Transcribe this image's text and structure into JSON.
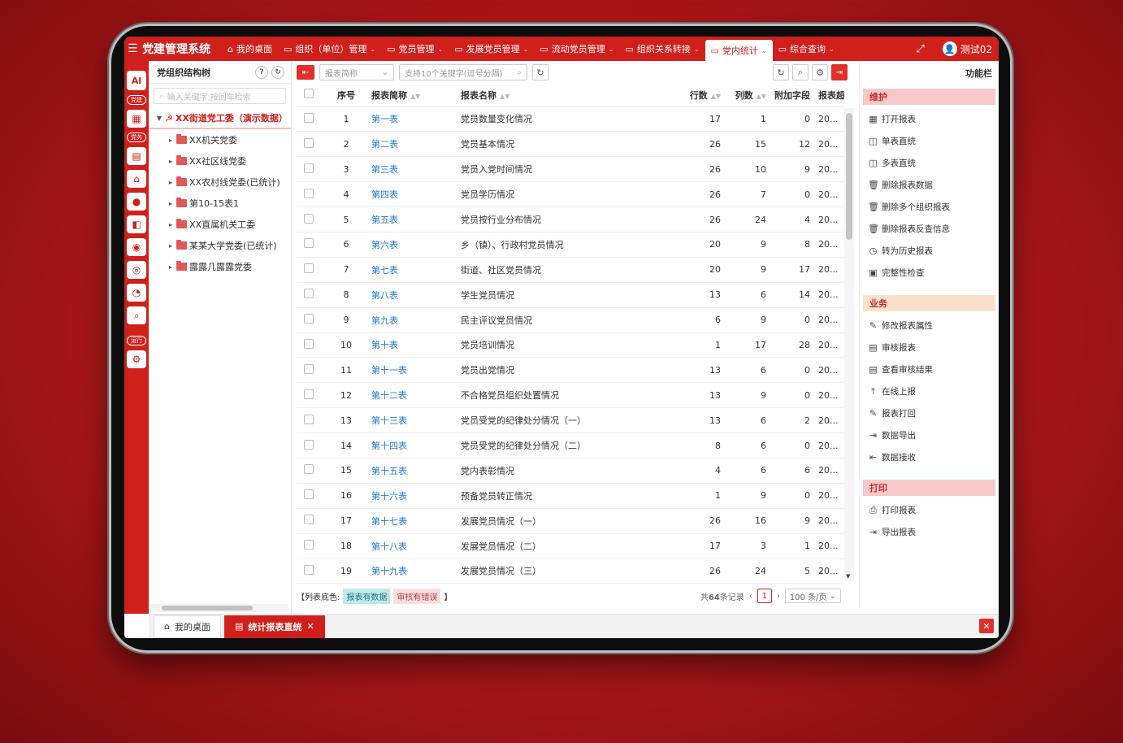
{
  "app": {
    "title": "党建管理系统",
    "user": "测试02"
  },
  "nav": [
    {
      "label": "我的桌面",
      "icon": "home-icon",
      "dropdown": false,
      "active": false
    },
    {
      "label": "组织（单位）管理",
      "icon": "folder-icon",
      "dropdown": true,
      "active": false
    },
    {
      "label": "党员管理",
      "icon": "folder-icon",
      "dropdown": true,
      "active": false
    },
    {
      "label": "发展党员管理",
      "icon": "folder-icon",
      "dropdown": true,
      "active": false
    },
    {
      "label": "流动党员管理",
      "icon": "folder-icon",
      "dropdown": true,
      "active": false
    },
    {
      "label": "组织关系转接",
      "icon": "folder-icon",
      "dropdown": true,
      "active": false
    },
    {
      "label": "党内统计",
      "icon": "folder-icon",
      "dropdown": true,
      "active": true
    },
    {
      "label": "综合查询",
      "icon": "folder-icon",
      "dropdown": true,
      "active": false
    }
  ],
  "rail": {
    "ai": "AI",
    "tag1": "党建",
    "tag2": "党务",
    "tag3": "运行"
  },
  "tree": {
    "title": "党组织结构树",
    "search_placeholder": "输入关键字,按回车检索",
    "root": "XX街道党工委（演示数据）",
    "children": [
      "XX机关党委",
      "XX社区线党委",
      "XX农村线党委(已统计)",
      "第10-15表1",
      "XX直属机关工委",
      "某某大学党委(已统计)",
      "露露几露露党委"
    ]
  },
  "toolbar": {
    "select_placeholder": "报表简称",
    "search_placeholder": "支持10个关键字(逗号分隔)"
  },
  "table": {
    "headers": {
      "no": "序号",
      "short": "报表简称",
      "name": "报表名称",
      "rows": "行数",
      "cols": "列数",
      "extra": "附加字段",
      "rep": "报表超"
    },
    "rows": [
      {
        "no": "1",
        "short": "第一表",
        "name": "党员数量变化情况",
        "rows": "17",
        "cols": "1",
        "extra": "0",
        "rep": "20..."
      },
      {
        "no": "2",
        "short": "第二表",
        "name": "党员基本情况",
        "rows": "26",
        "cols": "15",
        "extra": "12",
        "rep": "20..."
      },
      {
        "no": "3",
        "short": "第三表",
        "name": "党员入党时间情况",
        "rows": "26",
        "cols": "10",
        "extra": "9",
        "rep": "20..."
      },
      {
        "no": "4",
        "short": "第四表",
        "name": "党员学历情况",
        "rows": "26",
        "cols": "7",
        "extra": "0",
        "rep": "20..."
      },
      {
        "no": "5",
        "short": "第五表",
        "name": "党员按行业分布情况",
        "rows": "26",
        "cols": "24",
        "extra": "4",
        "rep": "20..."
      },
      {
        "no": "6",
        "short": "第六表",
        "name": "乡（镇）、行政村党员情况",
        "rows": "20",
        "cols": "9",
        "extra": "8",
        "rep": "20..."
      },
      {
        "no": "7",
        "short": "第七表",
        "name": "街道、社区党员情况",
        "rows": "20",
        "cols": "9",
        "extra": "17",
        "rep": "20..."
      },
      {
        "no": "8",
        "short": "第八表",
        "name": "学生党员情况",
        "rows": "13",
        "cols": "6",
        "extra": "14",
        "rep": "20..."
      },
      {
        "no": "9",
        "short": "第九表",
        "name": "民主评议党员情况",
        "rows": "6",
        "cols": "9",
        "extra": "0",
        "rep": "20..."
      },
      {
        "no": "10",
        "short": "第十表",
        "name": "党员培训情况",
        "rows": "1",
        "cols": "17",
        "extra": "28",
        "rep": "20..."
      },
      {
        "no": "11",
        "short": "第十一表",
        "name": "党员出党情况",
        "rows": "13",
        "cols": "6",
        "extra": "0",
        "rep": "20..."
      },
      {
        "no": "12",
        "short": "第十二表",
        "name": "不合格党员组织处置情况",
        "rows": "13",
        "cols": "9",
        "extra": "0",
        "rep": "20..."
      },
      {
        "no": "13",
        "short": "第十三表",
        "name": "党员受党的纪律处分情况（一）",
        "rows": "13",
        "cols": "6",
        "extra": "2",
        "rep": "20..."
      },
      {
        "no": "14",
        "short": "第十四表",
        "name": "党员受党的纪律处分情况（二）",
        "rows": "8",
        "cols": "6",
        "extra": "0",
        "rep": "20..."
      },
      {
        "no": "15",
        "short": "第十五表",
        "name": "党内表彰情况",
        "rows": "4",
        "cols": "6",
        "extra": "6",
        "rep": "20..."
      },
      {
        "no": "16",
        "short": "第十六表",
        "name": "预备党员转正情况",
        "rows": "1",
        "cols": "9",
        "extra": "0",
        "rep": "20..."
      },
      {
        "no": "17",
        "short": "第十七表",
        "name": "发展党员情况（一）",
        "rows": "26",
        "cols": "16",
        "extra": "9",
        "rep": "20..."
      },
      {
        "no": "18",
        "short": "第十八表",
        "name": "发展党员情况（二）",
        "rows": "17",
        "cols": "3",
        "extra": "1",
        "rep": "20..."
      },
      {
        "no": "19",
        "short": "第十九表",
        "name": "发展党员情况（三）",
        "rows": "26",
        "cols": "24",
        "extra": "5",
        "rep": "20..."
      }
    ]
  },
  "footer": {
    "legend_prefix": "【列表底色:",
    "chip_data": "报表有数据",
    "chip_error": "审核有错误",
    "legend_suffix": "】",
    "total_prefix": "共",
    "total_count": "64",
    "total_suffix": "条记录",
    "page": "1",
    "page_size": "100 条/页"
  },
  "func": {
    "title": "功能栏",
    "sections": [
      {
        "name": "维护",
        "items": [
          {
            "label": "打开报表",
            "icon": "table-icon"
          },
          {
            "label": "单表直统",
            "icon": "chart-icon"
          },
          {
            "label": "多表直统",
            "icon": "chart-icon"
          },
          {
            "label": "删除报表数据",
            "icon": "trash-icon"
          },
          {
            "label": "删除多个组织报表",
            "icon": "trash-icon"
          },
          {
            "label": "删除报表反查信息",
            "icon": "trash-icon"
          },
          {
            "label": "转为历史报表",
            "icon": "clock-icon"
          },
          {
            "label": "完整性检查",
            "icon": "check-icon"
          }
        ]
      },
      {
        "name": "业务",
        "items": [
          {
            "label": "修改报表属性",
            "icon": "edit-icon"
          },
          {
            "label": "审核报表",
            "icon": "audit-icon"
          },
          {
            "label": "查看审核结果",
            "icon": "audit-icon"
          },
          {
            "label": "在线上报",
            "icon": "upload-icon"
          },
          {
            "label": "报表打回",
            "icon": "edit-icon"
          },
          {
            "label": "数据导出",
            "icon": "export-icon"
          },
          {
            "label": "数据接收",
            "icon": "import-icon"
          }
        ]
      },
      {
        "name": "打印",
        "items": [
          {
            "label": "打印报表",
            "icon": "print-icon"
          },
          {
            "label": "导出报表",
            "icon": "export-icon"
          }
        ]
      }
    ]
  },
  "bottom_tabs": [
    {
      "label": "我的桌面",
      "icon": "home-icon",
      "active": false
    },
    {
      "label": "统计报表直统",
      "icon": "doc-icon",
      "active": true
    }
  ],
  "colors": {
    "primary": "#d0201c",
    "link": "#1e7ad6",
    "chip_data_bg": "#bfe8ea",
    "chip_error_bg": "#fadede"
  }
}
